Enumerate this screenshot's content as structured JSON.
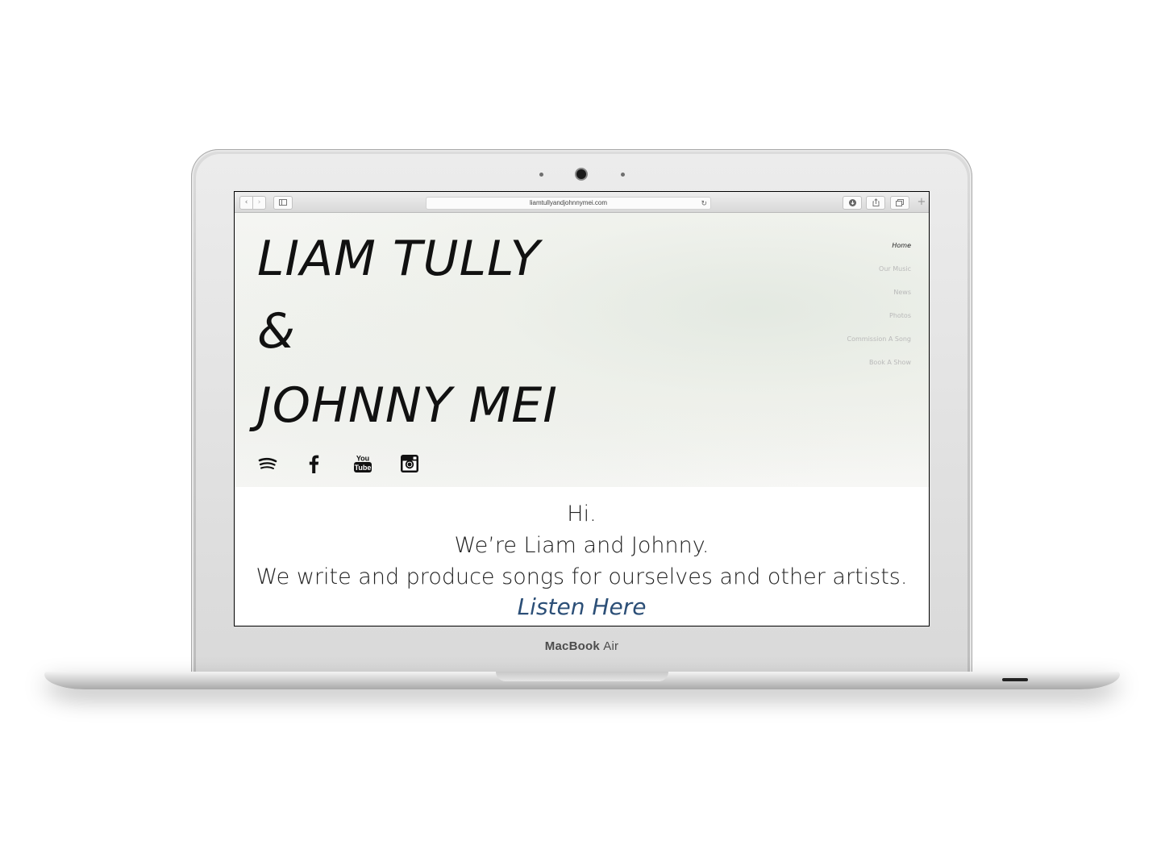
{
  "laptop": {
    "brand": "MacBook",
    "model": "Air"
  },
  "browser": {
    "url": "liamtullyandjohnnymei.com",
    "back_icon": "chevron-left-icon",
    "forward_icon": "chevron-right-icon",
    "sidebar_icon": "sidebar-icon",
    "reload_icon": "reload-icon",
    "download_icon": "download-icon",
    "share_icon": "share-icon",
    "tabs_icon": "tabs-icon",
    "new_tab_icon": "plus-icon"
  },
  "hero": {
    "title_line_1": "LIAM TULLY",
    "title_line_2": "&",
    "title_line_3": "JOHNNY MEI",
    "social_icons": [
      "spotify-icon",
      "facebook-icon",
      "youtube-icon",
      "instagram-icon"
    ]
  },
  "nav": {
    "items": [
      {
        "label": "Home",
        "active": true
      },
      {
        "label": "Our Music",
        "active": false
      },
      {
        "label": "News",
        "active": false
      },
      {
        "label": "Photos",
        "active": false
      },
      {
        "label": "Commission A Song",
        "active": false
      },
      {
        "label": "Book A Show",
        "active": false
      }
    ]
  },
  "intro": {
    "greeting": "Hi.",
    "line_2": "We’re Liam and Johnny.",
    "line_3": "We write and produce songs for ourselves and other artists.",
    "cta": "Listen Here"
  },
  "colors": {
    "cta": "#2c4f77",
    "nav_active": "#222222",
    "nav_inactive": "#b9b9b9"
  }
}
